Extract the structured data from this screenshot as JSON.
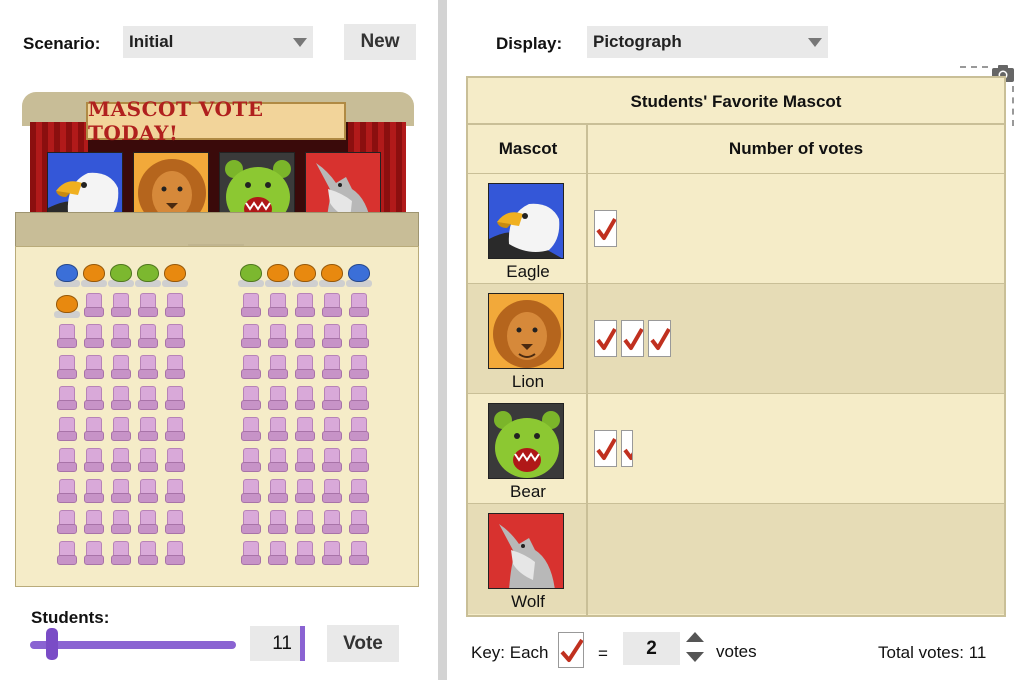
{
  "controls": {
    "scenario_label": "Scenario:",
    "scenario_value": "Initial",
    "new_button": "New",
    "display_label": "Display:",
    "display_value": "Pictograph"
  },
  "stage": {
    "banner": "MASCOT VOTE TODAY!",
    "mascots": [
      "eagle-icon",
      "lion-icon",
      "bear-icon",
      "wolf-icon"
    ]
  },
  "classroom": {
    "students_seated": 11,
    "students_colors": {
      "left": [
        "#3b6fd8",
        "#e8890f",
        "#7cb82f",
        "#7cb82f",
        "#e8890f",
        "#e8890f"
      ],
      "right": [
        "#7cb82f",
        "#e8890f",
        "#e8890f",
        "#e8890f",
        "#3b6fd8"
      ]
    }
  },
  "students_control": {
    "label": "Students:",
    "value": "11",
    "vote_button": "Vote"
  },
  "pictograph": {
    "title": "Students' Favorite Mascot",
    "col_mascot": "Mascot",
    "col_votes": "Number of votes",
    "rows": [
      {
        "name": "Eagle",
        "icon": "eagle-icon",
        "symbols": 1
      },
      {
        "name": "Lion",
        "icon": "lion-icon",
        "symbols": 3
      },
      {
        "name": "Bear",
        "icon": "bear-icon",
        "symbols": 1.5
      },
      {
        "name": "Wolf",
        "icon": "wolf-icon",
        "symbols": 0
      }
    ]
  },
  "key": {
    "prefix": "Key: Each",
    "equals": "=",
    "value": "2",
    "suffix": "votes"
  },
  "total": "Total votes: 11",
  "colors": {
    "accent": "#8a63d2",
    "check": "#c0301f",
    "table_bg": "#f5ecc8"
  }
}
